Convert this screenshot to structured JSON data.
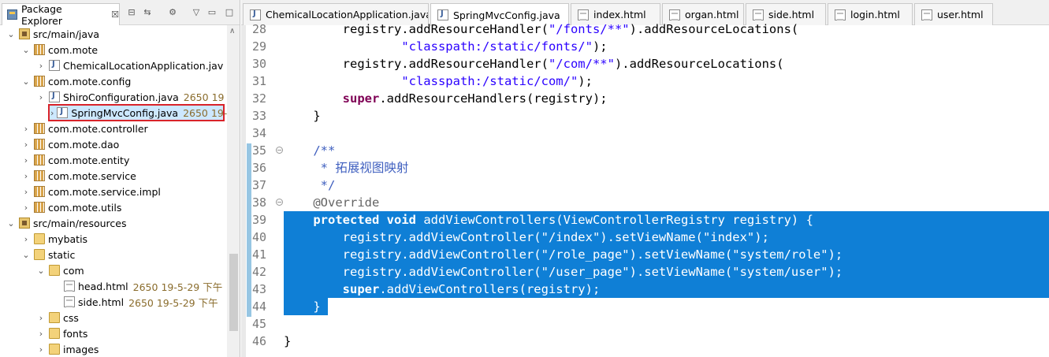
{
  "explorer": {
    "tab_title": "Package Explorer",
    "tab_close": "☒",
    "toolbar_icons": [
      "collapse-all-icon",
      "link-with-editor-icon",
      "filters-icon",
      "view-menu-icon",
      "minimize-icon",
      "maximize-icon"
    ],
    "tree": [
      {
        "label": "src/main/java",
        "icon": "source-folder-icon",
        "deco": "",
        "expanded": true,
        "indent": 1
      },
      {
        "label": "com.mote",
        "icon": "package-icon",
        "deco": "",
        "expanded": true,
        "indent": 2
      },
      {
        "label": "ChemicalLocationApplication.jav",
        "icon": "java-file-icon",
        "deco": "",
        "expanded": false,
        "indent": 3
      },
      {
        "label": "com.mote.config",
        "icon": "package-icon",
        "deco": "",
        "expanded": true,
        "indent": 2
      },
      {
        "label": "ShiroConfiguration.java",
        "icon": "java-file-icon",
        "deco": "2650  19",
        "expanded": false,
        "indent": 3
      },
      {
        "label": "SpringMvcConfig.java",
        "icon": "java-file-icon",
        "deco": "2650  19-",
        "expanded": false,
        "indent": 3,
        "highlighted": true
      },
      {
        "label": "com.mote.controller",
        "icon": "package-icon",
        "deco": "",
        "expanded": false,
        "indent": 2
      },
      {
        "label": "com.mote.dao",
        "icon": "package-icon",
        "deco": "",
        "expanded": false,
        "indent": 2
      },
      {
        "label": "com.mote.entity",
        "icon": "package-icon",
        "deco": "",
        "expanded": false,
        "indent": 2
      },
      {
        "label": "com.mote.service",
        "icon": "package-icon",
        "deco": "",
        "expanded": false,
        "indent": 2
      },
      {
        "label": "com.mote.service.impl",
        "icon": "package-icon",
        "deco": "",
        "expanded": false,
        "indent": 2
      },
      {
        "label": "com.mote.utils",
        "icon": "package-icon",
        "deco": "",
        "expanded": false,
        "indent": 2
      },
      {
        "label": "src/main/resources",
        "icon": "source-folder-icon",
        "deco": "",
        "expanded": true,
        "indent": 1
      },
      {
        "label": "mybatis",
        "icon": "folder-icon",
        "deco": "",
        "expanded": false,
        "indent": 2
      },
      {
        "label": "static",
        "icon": "folder-icon",
        "deco": "",
        "expanded": true,
        "indent": 2
      },
      {
        "label": "com",
        "icon": "folder-icon",
        "deco": "",
        "expanded": true,
        "indent": 3
      },
      {
        "label": "head.html",
        "icon": "html-file-icon",
        "deco": "2650  19-5-29 下午",
        "expanded": null,
        "indent": 4
      },
      {
        "label": "side.html",
        "icon": "html-file-icon",
        "deco": "2650  19-5-29 下午",
        "expanded": null,
        "indent": 4
      },
      {
        "label": "css",
        "icon": "folder-icon",
        "deco": "",
        "expanded": false,
        "indent": 3
      },
      {
        "label": "fonts",
        "icon": "folder-icon",
        "deco": "",
        "expanded": false,
        "indent": 3
      },
      {
        "label": "images",
        "icon": "folder-icon",
        "deco": "",
        "expanded": false,
        "indent": 3
      }
    ]
  },
  "editor": {
    "tabs": [
      {
        "label": "ChemicalLocationApplication.java",
        "icon": "java-file-icon",
        "active": false
      },
      {
        "label": "SpringMvcConfig.java",
        "icon": "java-file-icon",
        "active": true
      },
      {
        "label": "index.html",
        "icon": "html-file-icon",
        "active": false
      },
      {
        "label": "organ.html",
        "icon": "html-file-icon",
        "active": false
      },
      {
        "label": "side.html",
        "icon": "html-file-icon",
        "active": false
      },
      {
        "label": "login.html",
        "icon": "html-file-icon",
        "active": false
      },
      {
        "label": "user.html",
        "icon": "html-file-icon",
        "active": false
      }
    ],
    "lines": [
      {
        "n": "28",
        "fold": false,
        "selected": false,
        "parts": [
          [
            "",
            "        registry.addResourceHandler("
          ],
          [
            "str",
            "\"/fonts/**\""
          ],
          [
            "",
            ").addResourceLocations("
          ]
        ]
      },
      {
        "n": "29",
        "fold": false,
        "selected": false,
        "parts": [
          [
            "",
            "                "
          ],
          [
            "str",
            "\"classpath:/static/fonts/\""
          ],
          [
            "",
            ");"
          ]
        ]
      },
      {
        "n": "30",
        "fold": false,
        "selected": false,
        "parts": [
          [
            "",
            "        registry.addResourceHandler("
          ],
          [
            "str",
            "\"/com/**\""
          ],
          [
            "",
            ").addResourceLocations("
          ]
        ]
      },
      {
        "n": "31",
        "fold": false,
        "selected": false,
        "parts": [
          [
            "",
            "                "
          ],
          [
            "str",
            "\"classpath:/static/com/\""
          ],
          [
            "",
            ");"
          ]
        ]
      },
      {
        "n": "32",
        "fold": false,
        "selected": false,
        "parts": [
          [
            "",
            "        "
          ],
          [
            "kw",
            "super"
          ],
          [
            "",
            ".addResourceHandlers(registry);"
          ]
        ]
      },
      {
        "n": "33",
        "fold": false,
        "selected": false,
        "parts": [
          [
            "",
            "    }"
          ]
        ]
      },
      {
        "n": "34",
        "fold": false,
        "selected": false,
        "parts": [
          [
            "",
            ""
          ]
        ]
      },
      {
        "n": "35",
        "fold": true,
        "selected": false,
        "parts": [
          [
            "cmt",
            "    /**"
          ]
        ]
      },
      {
        "n": "36",
        "fold": false,
        "selected": false,
        "parts": [
          [
            "cmt",
            "     * 拓展视图映射"
          ]
        ]
      },
      {
        "n": "37",
        "fold": false,
        "selected": false,
        "parts": [
          [
            "cmt",
            "     */"
          ]
        ]
      },
      {
        "n": "38",
        "fold": true,
        "selected": false,
        "parts": [
          [
            "ann",
            "    @Override"
          ]
        ]
      },
      {
        "n": "39",
        "fold": false,
        "selected": true,
        "parts": [
          [
            "",
            "    "
          ],
          [
            "kw",
            "protected"
          ],
          [
            "",
            " "
          ],
          [
            "kw",
            "void"
          ],
          [
            "",
            " addViewControllers(ViewControllerRegistry registry) {"
          ]
        ]
      },
      {
        "n": "40",
        "fold": false,
        "selected": true,
        "parts": [
          [
            "",
            "        registry.addViewController("
          ],
          [
            "str",
            "\"/index\""
          ],
          [
            "",
            ").setViewName("
          ],
          [
            "str",
            "\"index\""
          ],
          [
            "",
            ");"
          ]
        ]
      },
      {
        "n": "41",
        "fold": false,
        "selected": true,
        "parts": [
          [
            "",
            "        registry.addViewController("
          ],
          [
            "str",
            "\"/role_page\""
          ],
          [
            "",
            ").setViewName("
          ],
          [
            "str",
            "\"system/role\""
          ],
          [
            "",
            ");"
          ]
        ]
      },
      {
        "n": "42",
        "fold": false,
        "selected": true,
        "parts": [
          [
            "",
            "        registry.addViewController("
          ],
          [
            "str",
            "\"/user_page\""
          ],
          [
            "",
            ").setViewName("
          ],
          [
            "str",
            "\"system/user\""
          ],
          [
            "",
            ");"
          ]
        ]
      },
      {
        "n": "43",
        "fold": false,
        "selected": true,
        "parts": [
          [
            "",
            "        "
          ],
          [
            "kw",
            "super"
          ],
          [
            "",
            ".addViewControllers(registry);"
          ]
        ]
      },
      {
        "n": "44",
        "fold": false,
        "selected": true,
        "parts": [
          [
            "",
            "    }"
          ]
        ]
      },
      {
        "n": "45",
        "fold": false,
        "selected": false,
        "parts": [
          [
            "",
            ""
          ]
        ]
      },
      {
        "n": "46",
        "fold": false,
        "selected": false,
        "parts": [
          [
            "",
            "}"
          ]
        ]
      }
    ]
  },
  "colors": {
    "selection": "#0f7fd6",
    "keyword": "#7f0055",
    "string": "#2a00ff",
    "javadoc": "#3f5fbf",
    "annotation": "#646464",
    "highlight_box": "#d9232a"
  }
}
